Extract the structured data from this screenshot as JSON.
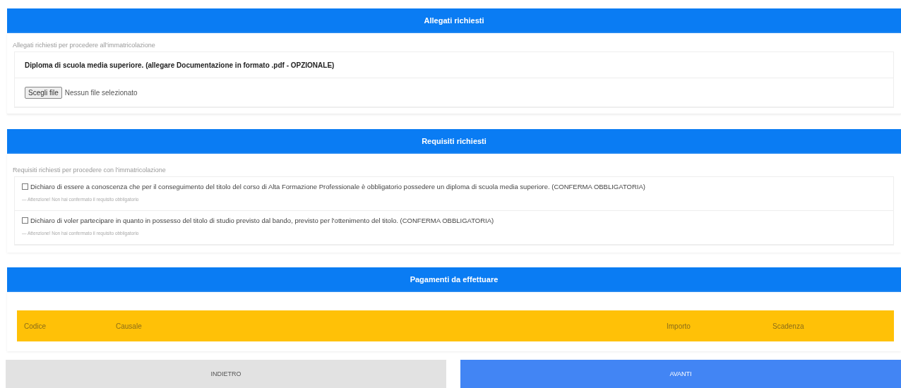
{
  "allegati": {
    "title": "Allegati richiesti",
    "subtitle": "Allegati richiesti per procedere all'immatricolazione",
    "items": [
      {
        "label": "Diploma di scuola media superiore. (allegare Documentazione in formato .pdf - OPZIONALE)",
        "button": "Scegli file",
        "status": "Nessun file selezionato"
      }
    ]
  },
  "requisiti": {
    "title": "Requisiti richiesti",
    "subtitle": "Requisiti richiesti per procedere con l'immatricolazione",
    "items": [
      {
        "label": "Dichiaro di essere a conoscenza che per il conseguimento del titolo del corso di Alta Formazione Professionale è obbligatorio possedere un diploma di scuola media superiore. (CONFERMA OBBLIGATORIA)",
        "checked": false,
        "warning": "— Attenzione! Non hai confermato il requisito obbligatorio"
      },
      {
        "label": "Dichiaro di voler partecipare in quanto in possesso del titolo di studio previsto dal bando, previsto per l'ottenimento del titolo. (CONFERMA OBBLIGATORIA)",
        "checked": false,
        "warning": "— Attenzione! Non hai confermato il requisito obbligatorio"
      }
    ]
  },
  "pagamenti": {
    "title": "Pagamenti da effettuare",
    "columns": [
      "Codice",
      "Causale",
      "Importo",
      "Scadenza"
    ]
  },
  "buttons": [
    {
      "label": "INDIETRO",
      "kind": "secondary"
    },
    {
      "label": "AVANTI",
      "kind": "primary"
    }
  ]
}
